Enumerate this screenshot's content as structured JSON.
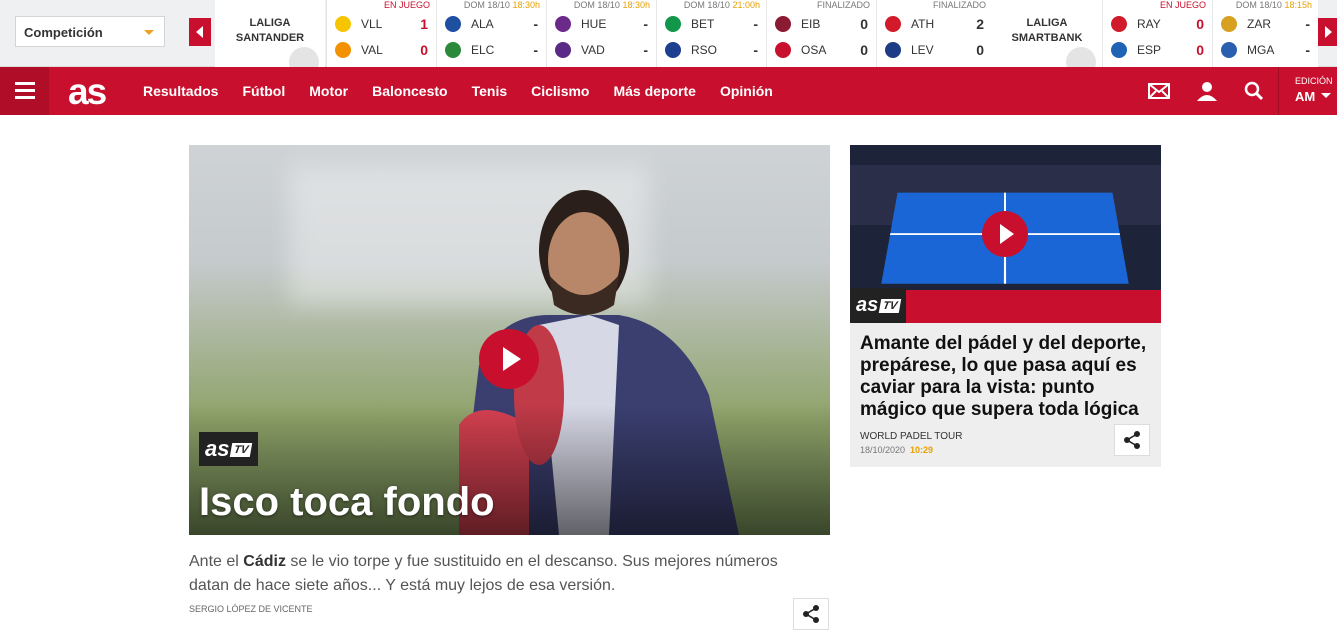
{
  "scores": {
    "competition_label": "Competición",
    "league1": {
      "name1": "LALIGA",
      "name2": "SANTANDER"
    },
    "league2": {
      "name1": "LALIGA",
      "name2": "SMARTBANK"
    },
    "matches": [
      {
        "status": "EN JUEGO",
        "status_type": "live",
        "time": "",
        "home": "VLL",
        "away": "VAL",
        "hs": "1",
        "as": "0",
        "hc": "#f6c500",
        "ac": "#f39200"
      },
      {
        "status": "DOM 18/10",
        "status_type": "scheduled",
        "time": "18:30h",
        "home": "ALA",
        "away": "ELC",
        "hs": "-",
        "as": "-",
        "hc": "#1e4fa0",
        "ac": "#2a8a3a"
      },
      {
        "status": "DOM 18/10",
        "status_type": "scheduled",
        "time": "18:30h",
        "home": "HUE",
        "away": "VAD",
        "hs": "-",
        "as": "-",
        "hc": "#6b2a8a",
        "ac": "#5b2a86"
      },
      {
        "status": "DOM 18/10",
        "status_type": "scheduled",
        "time": "21:00h",
        "home": "BET",
        "away": "RSO",
        "hs": "-",
        "as": "-",
        "hc": "#11964a",
        "ac": "#1c3f8f"
      },
      {
        "status": "FINALIZADO",
        "status_type": "final",
        "time": "",
        "home": "EIB",
        "away": "OSA",
        "hs": "0",
        "as": "0",
        "hc": "#8b1a33",
        "ac": "#c8102e"
      },
      {
        "status": "FINALIZADO",
        "status_type": "final",
        "time": "",
        "home": "ATH",
        "away": "LEV",
        "hs": "2",
        "as": "0",
        "hc": "#d11a2a",
        "ac": "#1e3b85"
      },
      {
        "status": "EN JUEGO",
        "status_type": "live",
        "time": "",
        "home": "RAY",
        "away": "ESP",
        "hs": "0",
        "as": "0",
        "hc": "#d11a2a",
        "ac": "#1f63b5"
      },
      {
        "status": "DOM 18/10",
        "status_type": "scheduled",
        "time": "18:15h",
        "home": "ZAR",
        "away": "MGA",
        "hs": "-",
        "as": "-",
        "hc": "#d8a020",
        "ac": "#2a5fb0"
      }
    ]
  },
  "nav": {
    "logo": "as",
    "menu": [
      "Resultados",
      "Fútbol",
      "Motor",
      "Baloncesto",
      "Tenis",
      "Ciclismo",
      "Más deporte",
      "Opinión"
    ],
    "edition_label": "EDICIÓN",
    "edition_value": "AM"
  },
  "hero": {
    "badge": "as",
    "badge_tv": "TV",
    "title": "Isco toca fondo",
    "summary_pre": "Ante el ",
    "summary_bold": "Cádiz",
    "summary_post": " se le vio torpe y fue sustituido en el descanso. Sus mejores números datan de hace siete años... Y está muy lejos de esa versión.",
    "byline": "SERGIO LÓPEZ DE VICENTE"
  },
  "side": {
    "badge": "as",
    "badge_tv": "TV",
    "title": "Amante del pádel y del deporte, prepárese, lo que pasa aquí es caviar para la vista: punto mágico que supera toda lógica",
    "source": "WORLD PADEL TOUR",
    "date": "18/10/2020",
    "time": "10:29"
  }
}
